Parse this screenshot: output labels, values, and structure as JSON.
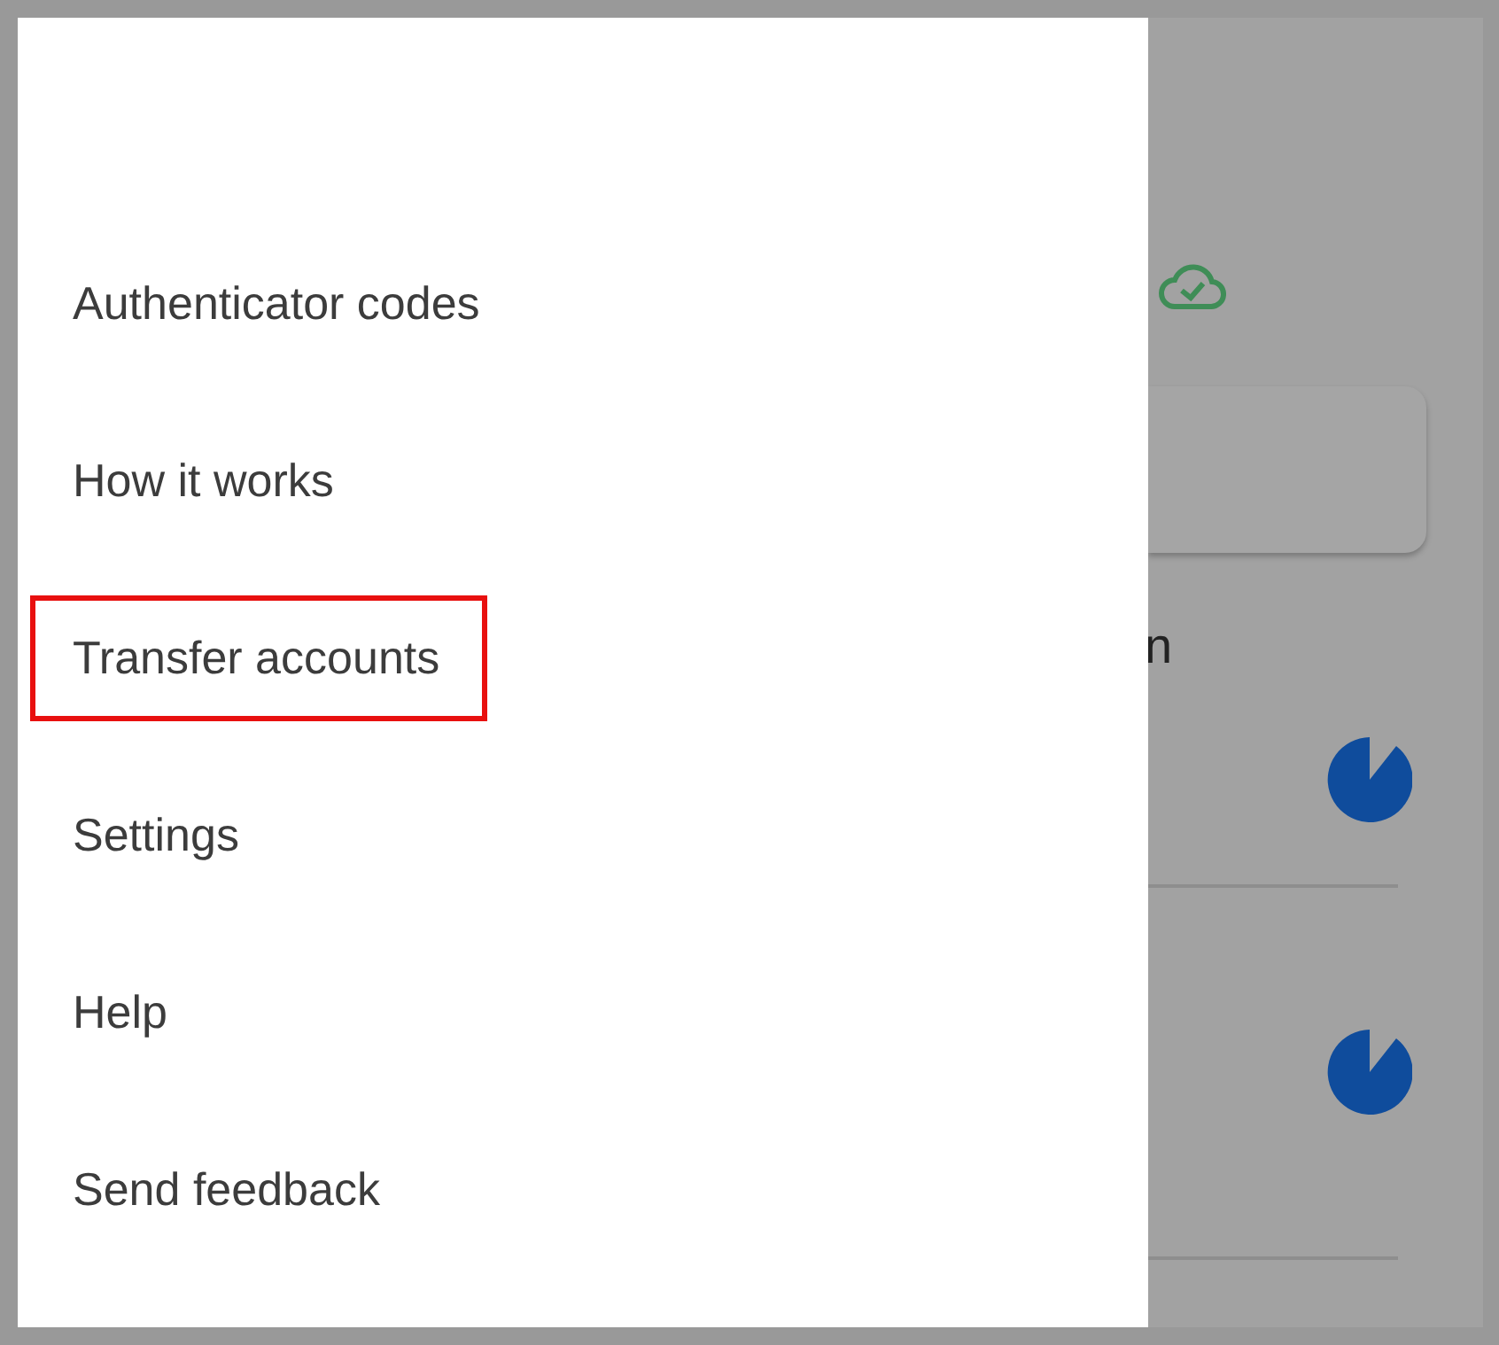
{
  "drawer": {
    "items": [
      {
        "label": "Authenticator codes",
        "highlighted": false
      },
      {
        "label": "How it works",
        "highlighted": false
      },
      {
        "label": "Transfer accounts",
        "highlighted": true
      },
      {
        "label": "Settings",
        "highlighted": false
      },
      {
        "label": "Help",
        "highlighted": false
      },
      {
        "label": "Send feedback",
        "highlighted": false
      }
    ]
  },
  "background": {
    "heading_fragment": "n",
    "rows": [
      {
        "kind": "code"
      },
      {
        "kind": "code"
      }
    ]
  }
}
